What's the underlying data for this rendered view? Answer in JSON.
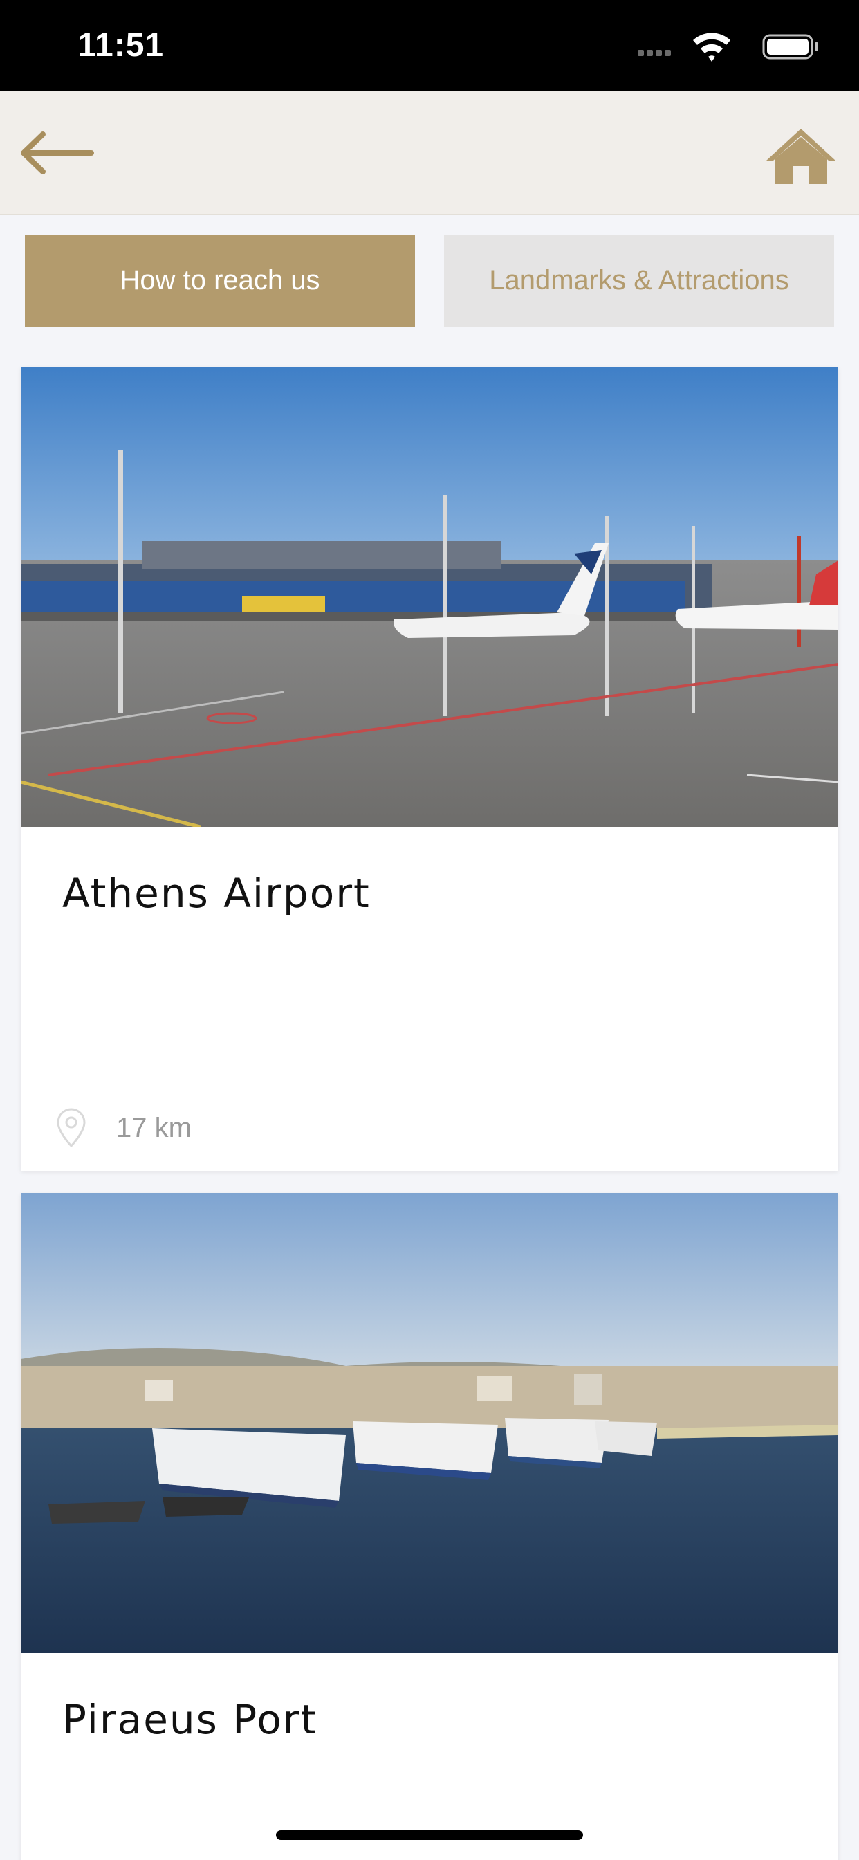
{
  "status_bar": {
    "time": "11:51",
    "icons": [
      "signal-icon",
      "wifi-icon",
      "battery-icon"
    ]
  },
  "nav": {
    "back_icon": "back-arrow-icon",
    "home_icon": "home-icon"
  },
  "tabs": [
    {
      "label": "How to reach us",
      "active": true
    },
    {
      "label": "Landmarks & Attractions",
      "active": false
    }
  ],
  "cards": [
    {
      "title": "Athens Airport",
      "distance": "17 km",
      "image": "airport-photo",
      "distance_icon": "location-pin-icon"
    },
    {
      "title": "Piraeus Port",
      "image": "port-photo"
    }
  ],
  "colors": {
    "accent": "#b39b6d",
    "nav_background": "#f1eeea",
    "inactive_tab": "#e5e4e4"
  }
}
